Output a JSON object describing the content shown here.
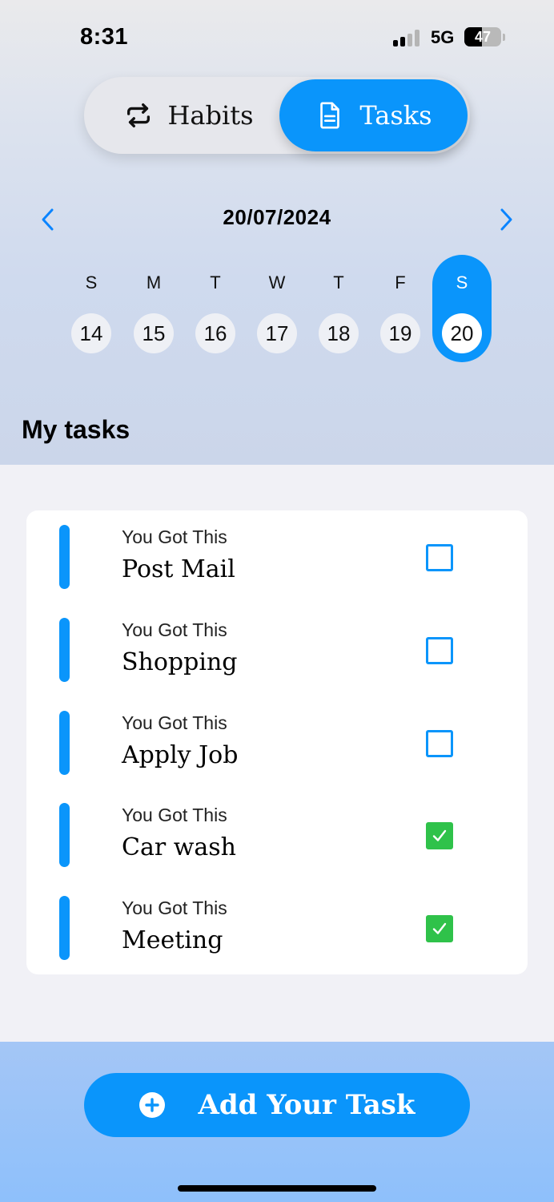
{
  "status_bar": {
    "time": "8:31",
    "network": "5G",
    "battery": "47",
    "battery_level": 0.47
  },
  "segment": {
    "habits_label": "Habits",
    "tasks_label": "Tasks",
    "selected": "tasks",
    "habits_icon": "repeat-icon",
    "tasks_icon": "document-icon"
  },
  "date_nav": {
    "date": "20/07/2024",
    "prev_icon": "chevron-left-icon",
    "next_icon": "chevron-right-icon"
  },
  "week": [
    {
      "letter": "S",
      "num": "14"
    },
    {
      "letter": "M",
      "num": "15"
    },
    {
      "letter": "T",
      "num": "16"
    },
    {
      "letter": "W",
      "num": "17"
    },
    {
      "letter": "T",
      "num": "18"
    },
    {
      "letter": "F",
      "num": "19"
    },
    {
      "letter": "S",
      "num": "20",
      "selected": true
    }
  ],
  "section_title": "My tasks",
  "tasks": [
    {
      "subtitle": "You Got This",
      "title": "Post Mail",
      "done": false
    },
    {
      "subtitle": "You Got This",
      "title": "Shopping",
      "done": false
    },
    {
      "subtitle": "You Got This",
      "title": "Apply Job",
      "done": false
    },
    {
      "subtitle": "You Got This",
      "title": "Car wash",
      "done": true
    },
    {
      "subtitle": "You Got This",
      "title": "Meeting",
      "done": true
    }
  ],
  "add_button": {
    "label": "Add Your Task",
    "icon": "plus-circle-icon"
  },
  "colors": {
    "accent": "#0a95fb",
    "done": "#2fc24a"
  }
}
